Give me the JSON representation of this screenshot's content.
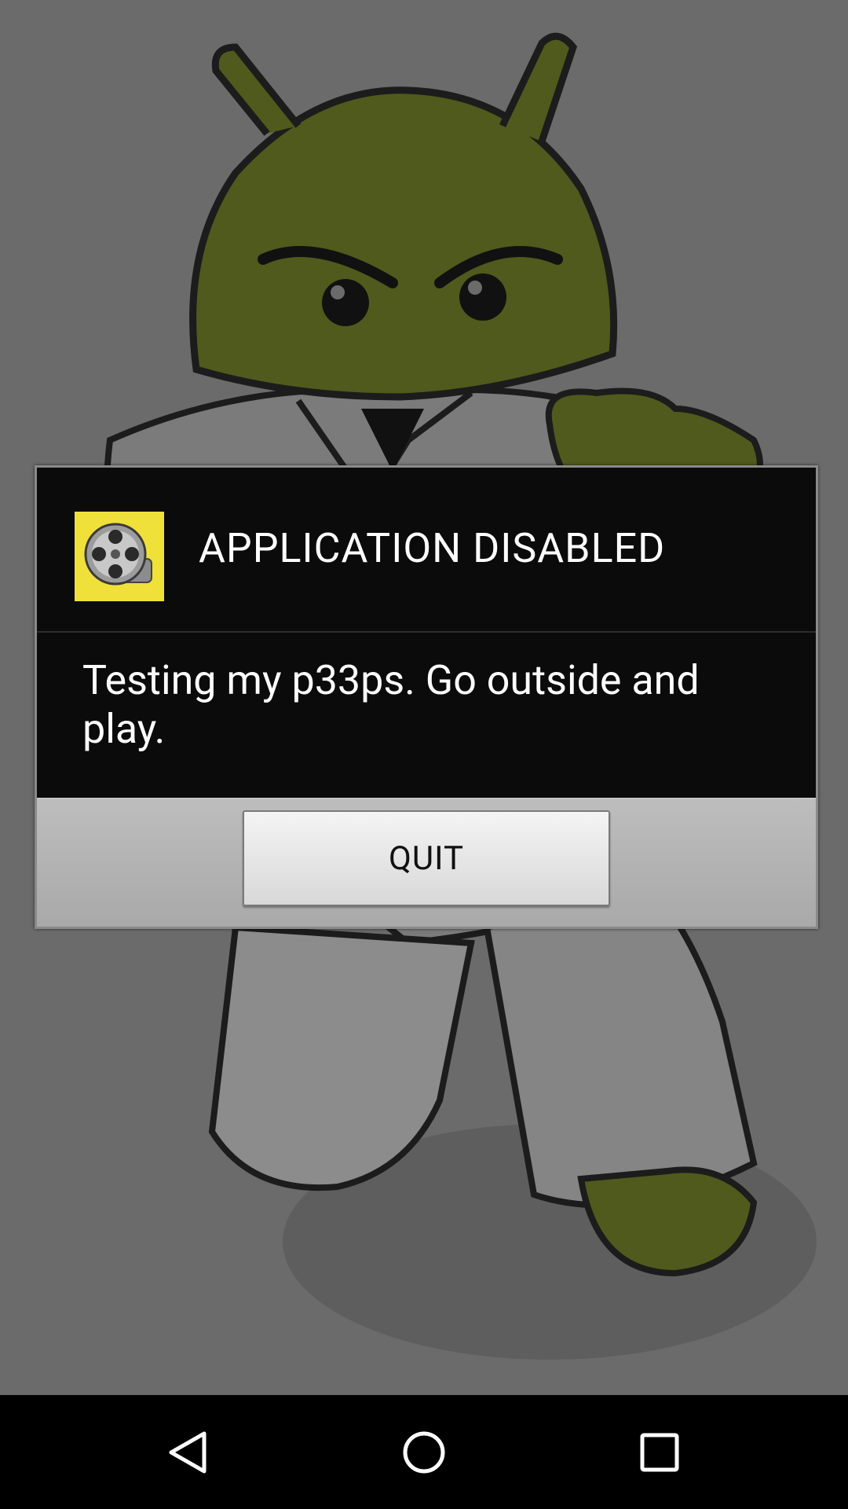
{
  "dialog": {
    "title": "APPLICATION DISABLED",
    "message": "Testing my p33ps. Go outside and play.",
    "app_icon": "film-reel-icon",
    "quit_label": "QUIT"
  },
  "navbar": {
    "back_icon": "back-triangle-icon",
    "home_icon": "home-circle-icon",
    "recents_icon": "recents-square-icon"
  },
  "colors": {
    "backdrop": "#6b6b6b",
    "dialog_bg": "#0b0b0b",
    "button_bar": "#b5b5b5",
    "icon_bg": "#f0e03a",
    "mascot_green": "#4f5a1c"
  }
}
